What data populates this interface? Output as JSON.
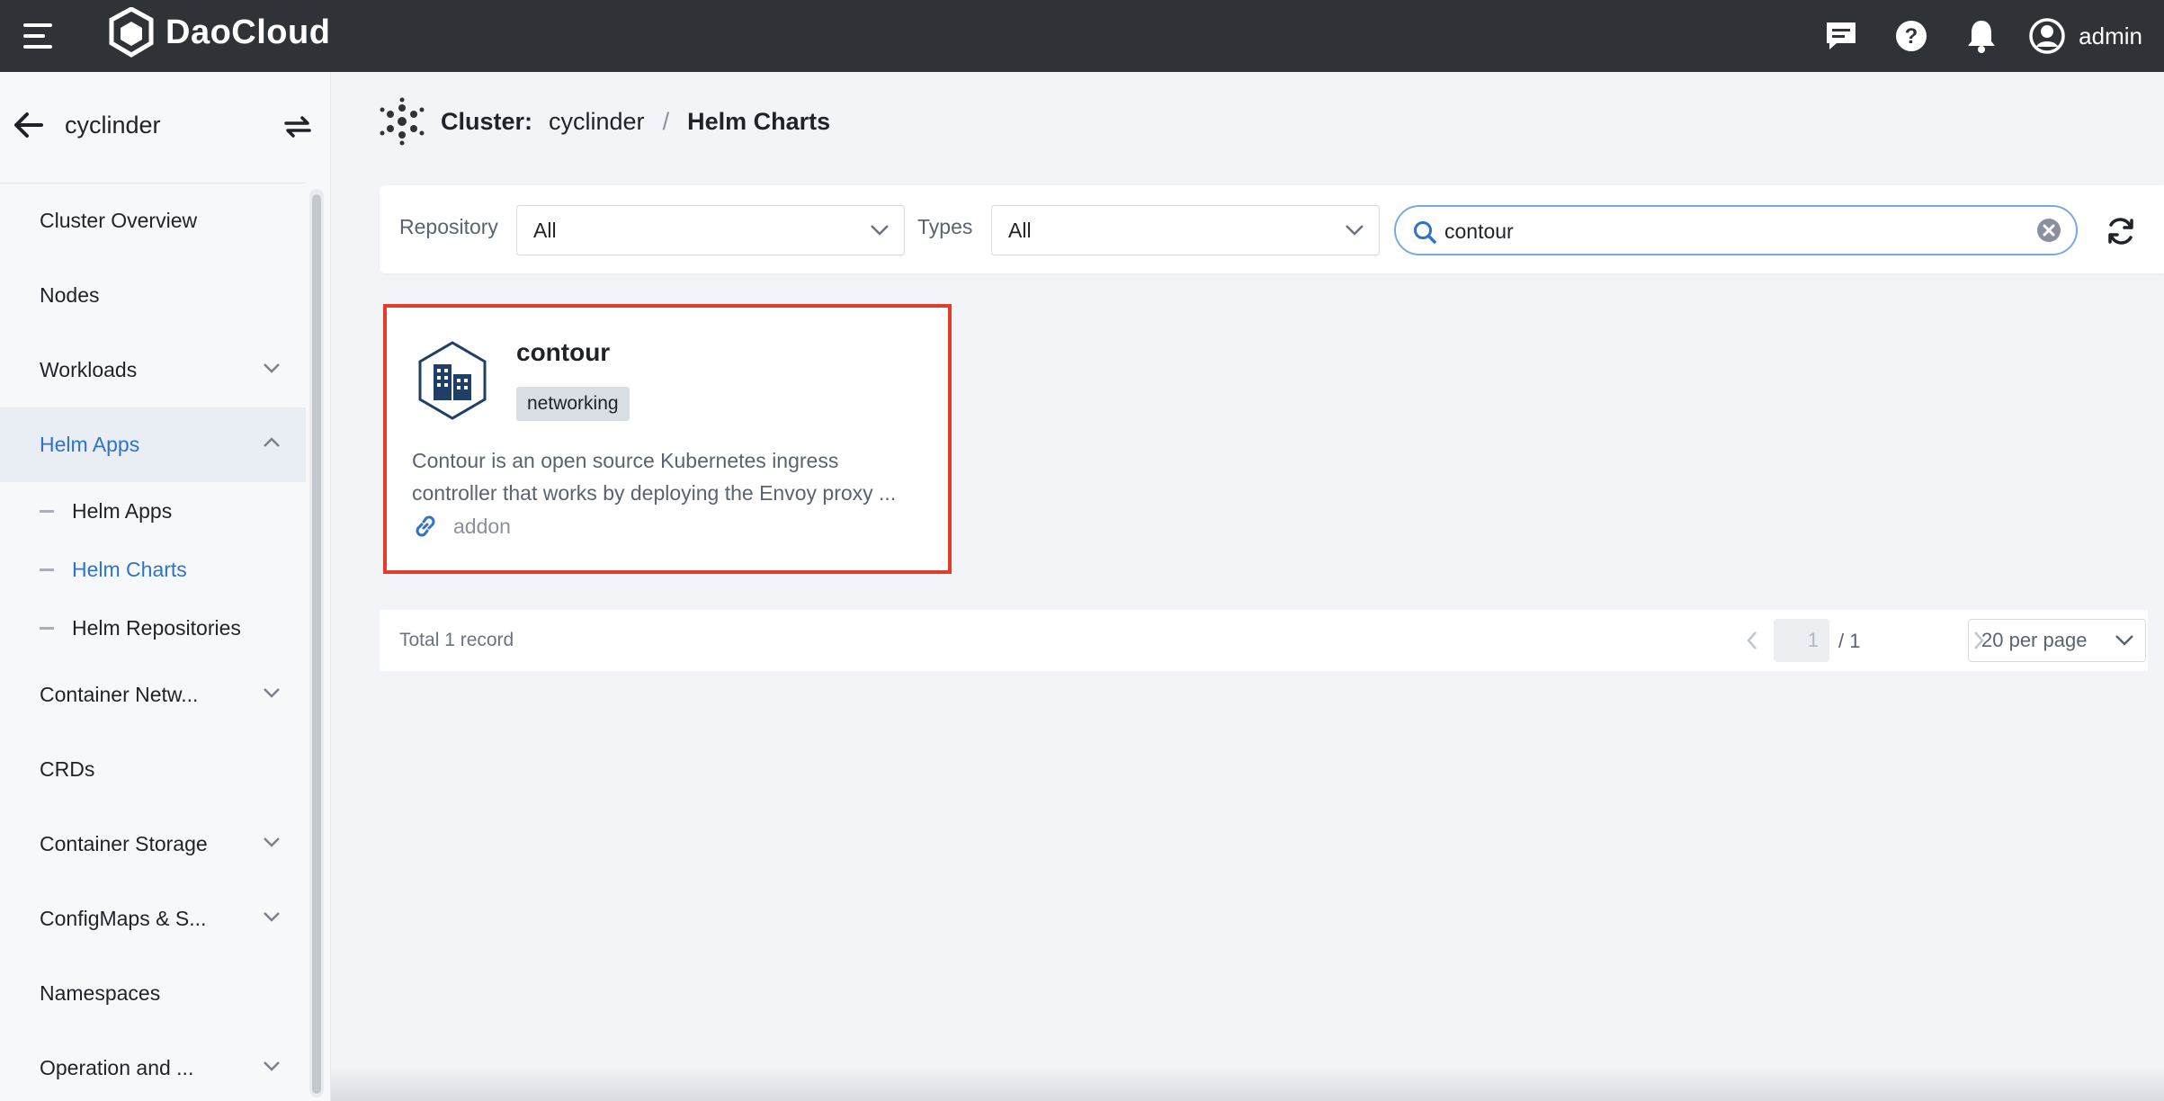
{
  "app": {
    "brand": "DaoCloud",
    "user": "admin"
  },
  "sidebar": {
    "cluster": "cyclinder",
    "items": [
      {
        "label": "Cluster Overview"
      },
      {
        "label": "Nodes"
      },
      {
        "label": "Workloads"
      },
      {
        "label": "Helm Apps"
      },
      {
        "label": "Container Netw..."
      },
      {
        "label": "CRDs"
      },
      {
        "label": "Container Storage"
      },
      {
        "label": "ConfigMaps & S..."
      },
      {
        "label": "Namespaces"
      },
      {
        "label": "Operation and ..."
      }
    ],
    "sub_items": [
      {
        "label": "Helm Apps"
      },
      {
        "label": "Helm Charts"
      },
      {
        "label": "Helm Repositories"
      }
    ]
  },
  "breadcrumb": {
    "cluster_label": "Cluster:",
    "cluster": "cyclinder",
    "separator": "/",
    "page": "Helm Charts"
  },
  "filters": {
    "repository_label": "Repository",
    "repository_value": "All",
    "types_label": "Types",
    "types_value": "All",
    "search_value": "contour"
  },
  "card": {
    "title": "contour",
    "tag": "networking",
    "description_line1": "Contour is an open source Kubernetes ingress",
    "description_line2": "controller that works by deploying the Envoy proxy ...",
    "repo": "addon"
  },
  "pagination": {
    "total": "Total 1 record",
    "current_page": "1",
    "page_total": "/ 1",
    "per_page": "20 per page"
  },
  "colors": {
    "accent": "#2f73c8",
    "highlight_border": "#e43c2c",
    "topbar": "#2f3237"
  }
}
